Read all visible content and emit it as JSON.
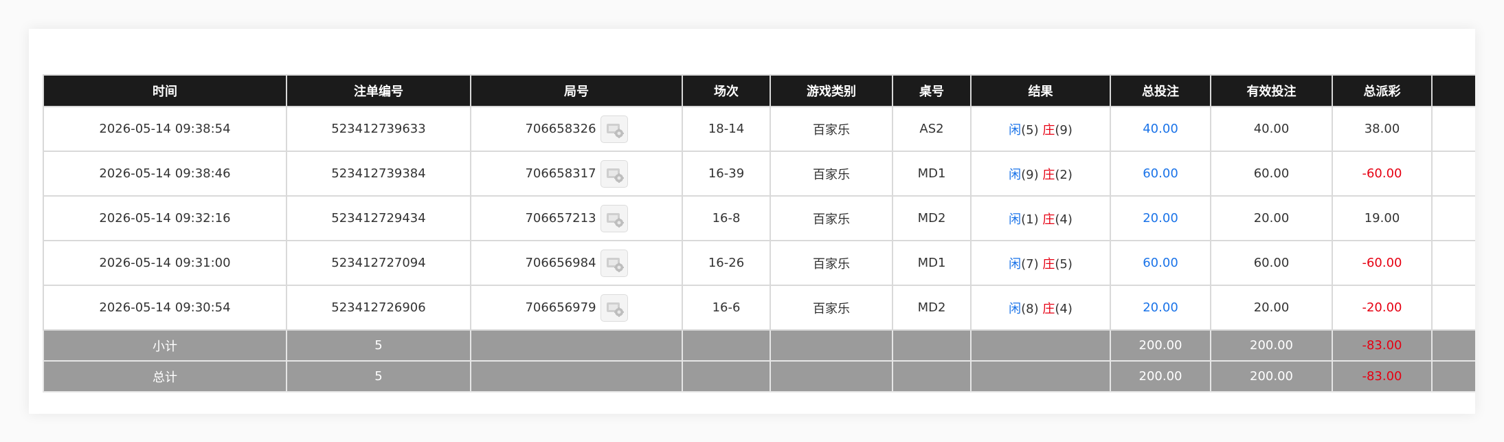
{
  "table": {
    "headers": [
      "时间",
      "注单编号",
      "局号",
      "场次",
      "游戏类别",
      "桌号",
      "结果",
      "总投注",
      "有效投注",
      "总派彩",
      ""
    ],
    "rows": [
      {
        "time": "2026-05-14 09:38:54",
        "order_no": "523412739633",
        "round_no": "706658326",
        "session": "18-14",
        "game": "百家乐",
        "table_no": "AS2",
        "result": {
          "player_label": "闲",
          "player_val": "(5)",
          "banker_label": "庄",
          "banker_val": "(9)"
        },
        "total_bet": "40.00",
        "valid_bet": "40.00",
        "payout": "38.00",
        "payout_color": "normal"
      },
      {
        "time": "2026-05-14 09:38:46",
        "order_no": "523412739384",
        "round_no": "706658317",
        "session": "16-39",
        "game": "百家乐",
        "table_no": "MD1",
        "result": {
          "player_label": "闲",
          "player_val": "(9)",
          "banker_label": "庄",
          "banker_val": "(2)"
        },
        "total_bet": "60.00",
        "valid_bet": "60.00",
        "payout": "-60.00",
        "payout_color": "red"
      },
      {
        "time": "2026-05-14 09:32:16",
        "order_no": "523412729434",
        "round_no": "706657213",
        "session": "16-8",
        "game": "百家乐",
        "table_no": "MD2",
        "result": {
          "player_label": "闲",
          "player_val": "(1)",
          "banker_label": "庄",
          "banker_val": "(4)"
        },
        "total_bet": "20.00",
        "valid_bet": "20.00",
        "payout": "19.00",
        "payout_color": "normal"
      },
      {
        "time": "2026-05-14 09:31:00",
        "order_no": "523412727094",
        "round_no": "706656984",
        "session": "16-26",
        "game": "百家乐",
        "table_no": "MD1",
        "result": {
          "player_label": "闲",
          "player_val": "(7)",
          "banker_label": "庄",
          "banker_val": "(5)"
        },
        "total_bet": "60.00",
        "valid_bet": "60.00",
        "payout": "-60.00",
        "payout_color": "red"
      },
      {
        "time": "2026-05-14 09:30:54",
        "order_no": "523412726906",
        "round_no": "706656979",
        "session": "16-6",
        "game": "百家乐",
        "table_no": "MD2",
        "result": {
          "player_label": "闲",
          "player_val": "(8)",
          "banker_label": "庄",
          "banker_val": "(4)"
        },
        "total_bet": "20.00",
        "valid_bet": "20.00",
        "payout": "-20.00",
        "payout_color": "red"
      }
    ],
    "subtotal": {
      "label": "小计",
      "count": "5",
      "total_bet": "200.00",
      "valid_bet": "200.00",
      "payout": "-83.00"
    },
    "total": {
      "label": "总计",
      "count": "5",
      "total_bet": "200.00",
      "valid_bet": "200.00",
      "payout": "-83.00"
    }
  },
  "icons": {
    "round_detail": "replay-thumbnail-icon"
  },
  "colors": {
    "header_bg": "#1b1b1b",
    "summary_bg": "#9b9b9b",
    "blue": "#1a73e8",
    "red": "#e60012"
  }
}
